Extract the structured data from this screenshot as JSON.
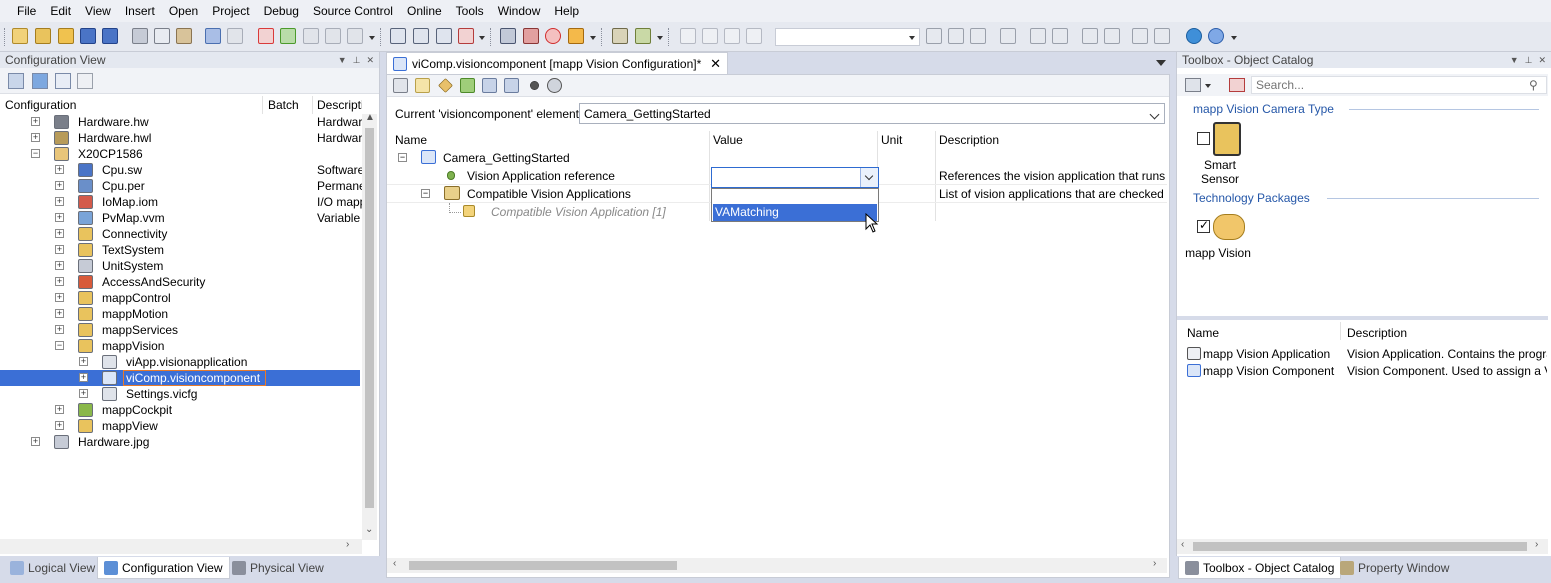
{
  "menu": [
    "File",
    "Edit",
    "View",
    "Insert",
    "Open",
    "Project",
    "Debug",
    "Source Control",
    "Online",
    "Tools",
    "Window",
    "Help"
  ],
  "config_view": {
    "title": "Configuration View",
    "columns": [
      "Configuration",
      "Batch",
      "Description"
    ],
    "rows": [
      {
        "label": "Hardware.hw",
        "desc": "Hardware"
      },
      {
        "label": "Hardware.hwl",
        "desc": "Hardware"
      },
      {
        "label": "X20CP1586",
        "desc": ""
      },
      {
        "label": "Cpu.sw",
        "desc": "Software"
      },
      {
        "label": "Cpu.per",
        "desc": "Permanent"
      },
      {
        "label": "IoMap.iom",
        "desc": "I/O mapping"
      },
      {
        "label": "PvMap.vvm",
        "desc": "Variable m"
      },
      {
        "label": "Connectivity",
        "desc": ""
      },
      {
        "label": "TextSystem",
        "desc": ""
      },
      {
        "label": "UnitSystem",
        "desc": ""
      },
      {
        "label": "AccessAndSecurity",
        "desc": ""
      },
      {
        "label": "mappControl",
        "desc": ""
      },
      {
        "label": "mappMotion",
        "desc": ""
      },
      {
        "label": "mappServices",
        "desc": ""
      },
      {
        "label": "mappVision",
        "desc": ""
      },
      {
        "label": "viApp.visionapplication",
        "desc": ""
      },
      {
        "label": "viComp.visioncomponent",
        "desc": ""
      },
      {
        "label": "Settings.vicfg",
        "desc": ""
      },
      {
        "label": "mappCockpit",
        "desc": ""
      },
      {
        "label": "mappView",
        "desc": ""
      },
      {
        "label": "Hardware.jpg",
        "desc": ""
      }
    ]
  },
  "bottom_tabs_left": [
    "Logical View",
    "Configuration View",
    "Physical View"
  ],
  "document": {
    "tab_title": "viComp.visioncomponent [mapp Vision Configuration]*",
    "current_label": "Current 'visioncomponent' element:",
    "current_value": "Camera_GettingStarted",
    "columns": [
      "Name",
      "Value",
      "Unit",
      "Description"
    ],
    "rows": [
      {
        "name": "Camera_GettingStarted",
        "value": "",
        "unit": "",
        "desc": ""
      },
      {
        "name": "Vision Application reference",
        "value": "",
        "unit": "",
        "desc": "References the vision application that runs on th"
      },
      {
        "name": "Compatible Vision Applications",
        "value": "",
        "unit": "",
        "desc": "List of vision applications that are checked for co"
      },
      {
        "name": "Compatible Vision Application [1]",
        "value": "",
        "unit": "",
        "desc": ""
      }
    ],
    "dropdown_option": "VAMatching"
  },
  "toolbox": {
    "title": "Toolbox - Object Catalog",
    "search_placeholder": "Search...",
    "category1": "mapp Vision Camera Type",
    "item1": "Smart Sensor",
    "category2": "Technology Packages",
    "item2": "mapp Vision",
    "columns": [
      "Name",
      "Description"
    ],
    "objects": [
      {
        "name": "mapp Vision Application",
        "desc": "Vision Application. Contains the program ex"
      },
      {
        "name": "mapp Vision Component",
        "desc": "Vision Component. Used to assign a Vision"
      }
    ]
  },
  "bottom_tabs_right": [
    "Toolbox - Object Catalog",
    "Property Window"
  ],
  "colors": {
    "selection": "#3b6fd6",
    "accent": "#2557a8"
  }
}
